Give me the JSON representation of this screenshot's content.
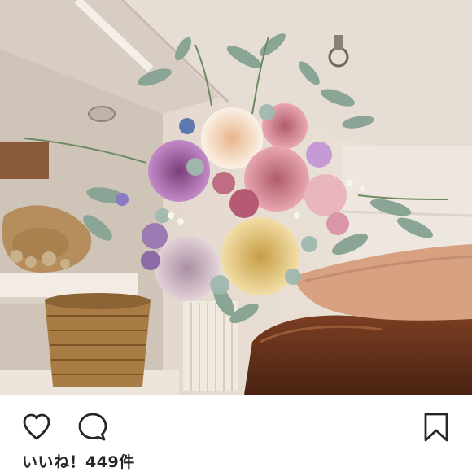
{
  "post": {
    "likes_text": "いいね！449件"
  },
  "icons": {
    "like": "heart-icon",
    "comment": "speech-bubble-icon",
    "save": "bookmark-icon"
  },
  "colors": {
    "icon": "#262626",
    "text": "#262626",
    "background": "#ffffff"
  }
}
